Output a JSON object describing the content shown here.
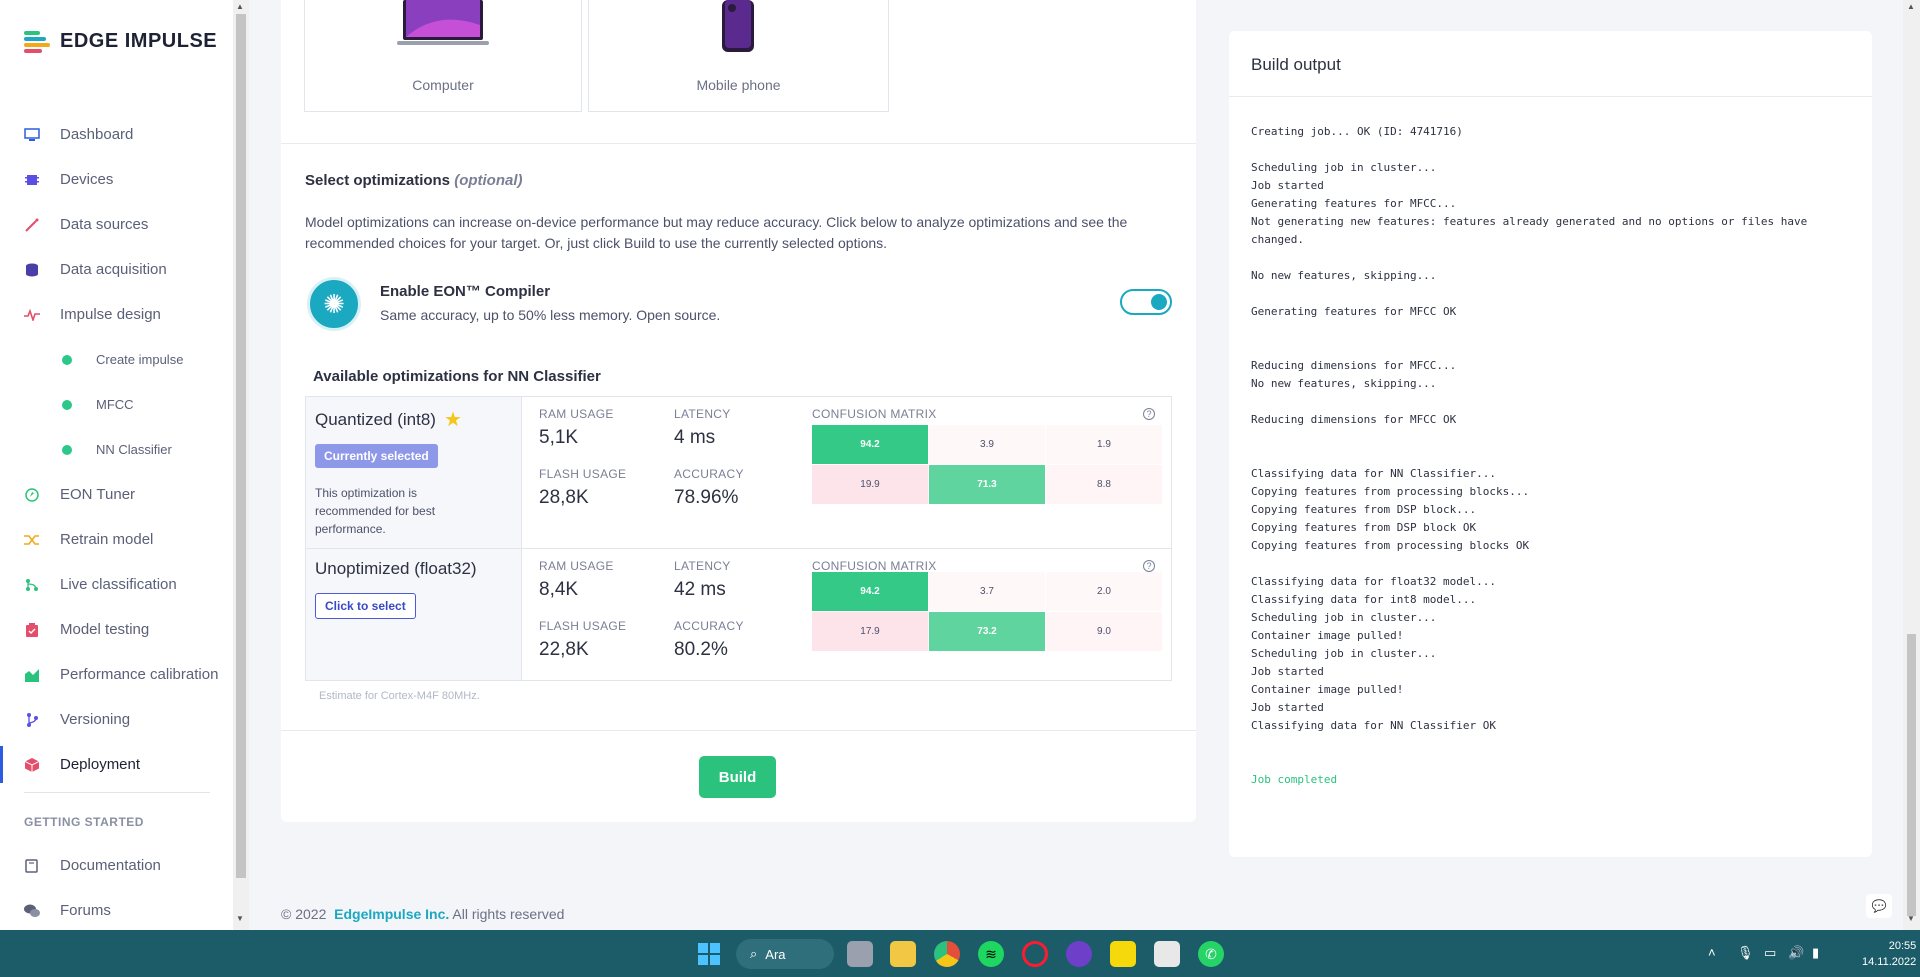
{
  "brand": {
    "name": "EDGE IMPULSE"
  },
  "sidebar": {
    "items": [
      {
        "label": "Dashboard",
        "icon": "monitor-icon",
        "color": "#2d5be3"
      },
      {
        "label": "Devices",
        "icon": "chip-icon",
        "color": "#5b4fe3"
      },
      {
        "label": "Data sources",
        "icon": "wand-icon",
        "color": "#e34f6b"
      },
      {
        "label": "Data acquisition",
        "icon": "database-icon",
        "color": "#4a3fa8"
      },
      {
        "label": "Impulse design",
        "icon": "pulse-icon",
        "color": "#e34f6b"
      },
      {
        "label": "Create impulse",
        "sub": true
      },
      {
        "label": "MFCC",
        "sub": true
      },
      {
        "label": "NN Classifier",
        "sub": true
      },
      {
        "label": "EON Tuner",
        "icon": "compass-icon",
        "color": "#2bc27e"
      },
      {
        "label": "Retrain model",
        "icon": "shuffle-icon",
        "color": "#f2a91a"
      },
      {
        "label": "Live classification",
        "icon": "tree-icon",
        "color": "#2bc27e"
      },
      {
        "label": "Model testing",
        "icon": "clipboard-icon",
        "color": "#e34f6b"
      },
      {
        "label": "Performance calibration",
        "icon": "chart-icon",
        "color": "#2bc27e"
      },
      {
        "label": "Versioning",
        "icon": "branch-icon",
        "color": "#5b4fe3"
      },
      {
        "label": "Deployment",
        "icon": "cube-icon",
        "color": "#e34f6b",
        "active": true
      }
    ],
    "section": "GETTING STARTED",
    "bottom_items": [
      {
        "label": "Documentation",
        "icon": "book-icon"
      },
      {
        "label": "Forums",
        "icon": "chat-icon"
      }
    ]
  },
  "devices": [
    {
      "label": "Computer"
    },
    {
      "label": "Mobile phone"
    }
  ],
  "optimizations": {
    "title": "Select optimizations",
    "title_optional": "(optional)",
    "description": "Model optimizations can increase on-device performance but may reduce accuracy. Click below to analyze optimizations and see the recommended choices for your target. Or, just click Build to use the currently selected options.",
    "eon_title": "Enable EON™ Compiler",
    "eon_sub": "Same accuracy, up to 50% less memory. Open source.",
    "eon_enabled": true,
    "available_title": "Available optimizations for NN Classifier",
    "labels": {
      "ram": "RAM USAGE",
      "latency": "LATENCY",
      "flash": "FLASH USAGE",
      "accuracy": "ACCURACY",
      "confusion": "CONFUSION MATRIX"
    },
    "rows": [
      {
        "name": "Quantized (int8)",
        "badge": "Currently selected",
        "note": "This optimization is recommended for best performance.",
        "ram": "5,1K",
        "latency": "4 ms",
        "flash": "28,8K",
        "accuracy": "78.96%",
        "matrix": [
          [
            "94.2",
            "3.9",
            "1.9"
          ],
          [
            "19.9",
            "71.3",
            "8.8"
          ]
        ]
      },
      {
        "name": "Unoptimized (float32)",
        "button": "Click to select",
        "ram": "8,4K",
        "latency": "42 ms",
        "flash": "22,8K",
        "accuracy": "80.2%",
        "matrix": [
          [
            "94.2",
            "3.7",
            "2.0"
          ],
          [
            "17.9",
            "73.2",
            "9.0"
          ]
        ]
      }
    ],
    "estimate": "Estimate for Cortex-M4F 80MHz.",
    "build_label": "Build"
  },
  "build_output": {
    "title": "Build output",
    "lines": [
      "Creating job... OK (ID: 4741716)",
      "",
      "Scheduling job in cluster...",
      "Job started",
      "Generating features for MFCC...",
      "Not generating new features: features already generated and no options or files have changed.",
      "",
      "No new features, skipping...",
      "",
      "Generating features for MFCC OK",
      "",
      "",
      "Reducing dimensions for MFCC...",
      "No new features, skipping...",
      "",
      "Reducing dimensions for MFCC OK",
      "",
      "",
      "Classifying data for NN Classifier...",
      "Copying features from processing blocks...",
      "Copying features from DSP block...",
      "Copying features from DSP block OK",
      "Copying features from processing blocks OK",
      "",
      "Classifying data for float32 model...",
      "Classifying data for int8 model...",
      "Scheduling job in cluster...",
      "Container image pulled!",
      "Scheduling job in cluster...",
      "Job started",
      "Container image pulled!",
      "Job started",
      "Classifying data for NN Classifier OK",
      "",
      ""
    ],
    "completed": "Job completed"
  },
  "footer": {
    "copyright": "© 2022",
    "company": "EdgeImpulse Inc.",
    "rights": "All rights reserved"
  },
  "taskbar": {
    "search_label": "Ara",
    "time": "20:55",
    "date": "14.11.2022"
  },
  "colors": {
    "accent_green": "#2bc27e",
    "accent_teal": "#1ba8c1",
    "taskbar": "#1c5c68"
  }
}
